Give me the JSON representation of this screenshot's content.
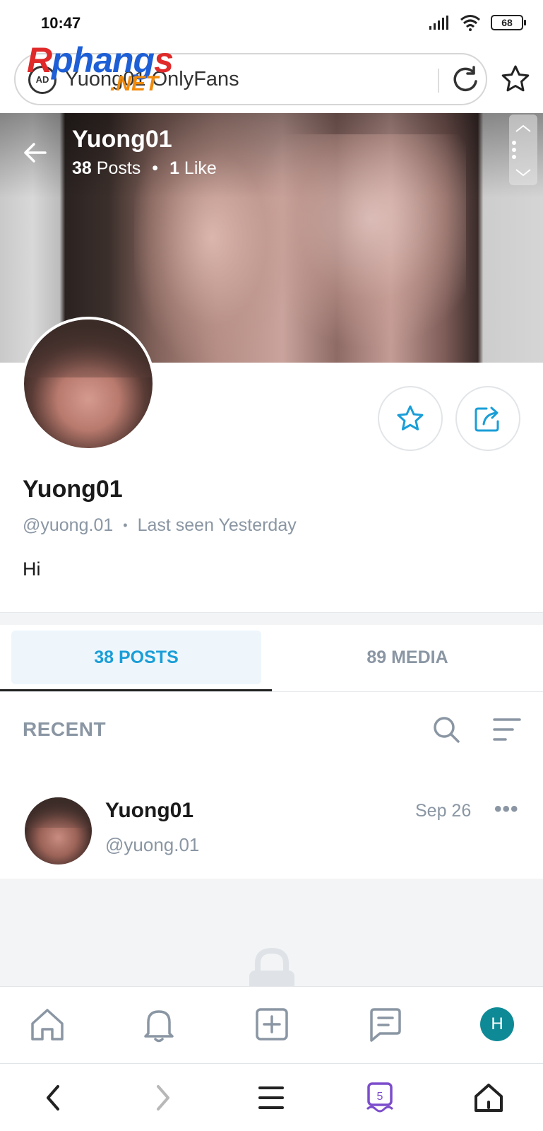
{
  "status_bar": {
    "time": "10:47",
    "battery": "68"
  },
  "browser": {
    "url_text": "Yuong01 OnlyFans",
    "ad_icon": "AD"
  },
  "watermark": {
    "main_r": "R",
    "main_rest": "phang",
    "main_s": "s",
    "net": ".NET"
  },
  "profile": {
    "cover_name": "Yuong01",
    "posts_count": "38",
    "posts_label": "Posts",
    "likes_count": "1",
    "likes_label": "Like",
    "name": "Yuong01",
    "handle": "@yuong.01",
    "last_seen": "Last seen Yesterday",
    "bio": "Hi"
  },
  "tabs": [
    {
      "label": "38 POSTS",
      "active": true
    },
    {
      "label": "89 MEDIA",
      "active": false
    }
  ],
  "feed": {
    "section_label": "RECENT",
    "post": {
      "name": "Yuong01",
      "handle": "@yuong.01",
      "date": "Sep 26",
      "more": "•••"
    }
  },
  "app_nav": {
    "avatar_initial": "H"
  },
  "browser_nav": {
    "tab_count": "5"
  },
  "colors": {
    "accent": "#1a9ed7",
    "muted": "#8a96a3",
    "avatar_bg": "#0e8a96",
    "tabs_purple": "#7c4dcc"
  },
  "icons": [
    "signal-icon",
    "wifi-icon",
    "battery-icon",
    "ad-block-icon",
    "reload-icon",
    "bookmark-star-icon",
    "back-arrow-icon",
    "star-icon",
    "share-icon",
    "search-icon",
    "sort-icon",
    "lock-icon",
    "home-icon",
    "bell-icon",
    "add-post-icon",
    "messages-icon",
    "chevron-left-icon",
    "chevron-right-icon",
    "menu-icon",
    "tabs-icon",
    "browser-home-icon"
  ]
}
